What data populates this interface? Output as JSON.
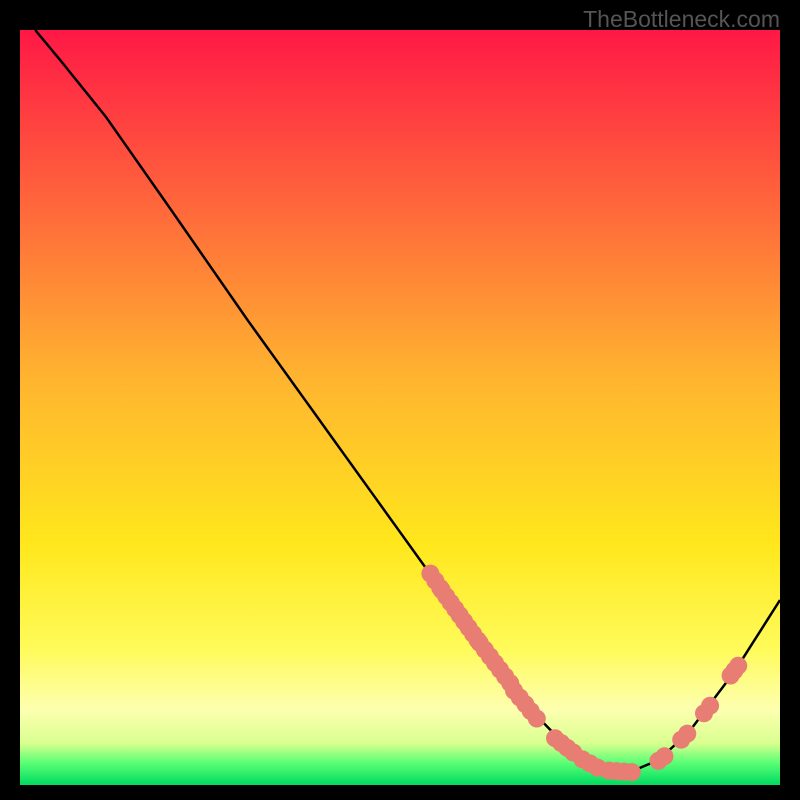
{
  "watermark": "TheBottleneck.com",
  "chart_data": {
    "type": "line",
    "title": "",
    "xlabel": "",
    "ylabel": "",
    "xlim": [
      0,
      100
    ],
    "ylim": [
      0,
      100
    ],
    "curve": [
      {
        "x": 2.0,
        "y": 100.0
      },
      {
        "x": 5.3,
        "y": 96.0
      },
      {
        "x": 11.3,
        "y": 88.5
      },
      {
        "x": 20.0,
        "y": 76.0
      },
      {
        "x": 30.0,
        "y": 61.5
      },
      {
        "x": 40.0,
        "y": 47.5
      },
      {
        "x": 50.0,
        "y": 33.5
      },
      {
        "x": 60.0,
        "y": 19.5
      },
      {
        "x": 66.7,
        "y": 10.5
      },
      {
        "x": 72.0,
        "y": 5.0
      },
      {
        "x": 76.0,
        "y": 2.3
      },
      {
        "x": 80.0,
        "y": 1.6
      },
      {
        "x": 84.0,
        "y": 3.3
      },
      {
        "x": 88.0,
        "y": 7.0
      },
      {
        "x": 94.0,
        "y": 15.0
      },
      {
        "x": 100.0,
        "y": 24.5
      }
    ],
    "dot_clusters": [
      {
        "x": 54.0,
        "x_end": 55.3,
        "y_start": 28.0,
        "y_end": 26.1
      },
      {
        "x": 55.5,
        "x_end": 60.2,
        "y_start": 25.8,
        "y_end": 19.2
      },
      {
        "x": 60.5,
        "x_end": 64.5,
        "y_start": 18.8,
        "y_end": 13.5
      },
      {
        "x": 65.0,
        "x_end": 66.5,
        "y_start": 12.5,
        "y_end": 10.7
      },
      {
        "x": 67.2,
        "x_end": 68.0,
        "y_start": 9.8,
        "y_end": 8.8
      },
      {
        "x": 70.4,
        "x_end": 72.8,
        "y_start": 6.2,
        "y_end": 4.3
      },
      {
        "x": 74.0,
        "x_end": 76.0,
        "y_start": 3.4,
        "y_end": 2.3
      },
      {
        "x": 77.5,
        "x_end": 80.5,
        "y_start": 1.9,
        "y_end": 1.7
      },
      {
        "x": 84.0,
        "x_end": 84.8,
        "y_start": 3.2,
        "y_end": 3.8
      },
      {
        "x": 87.0,
        "x_end": 87.8,
        "y_start": 6.0,
        "y_end": 6.8
      },
      {
        "x": 90.0,
        "x_end": 90.8,
        "y_start": 9.5,
        "y_end": 10.5
      },
      {
        "x": 93.5,
        "x_end": 94.5,
        "y_start": 14.5,
        "y_end": 15.8
      }
    ],
    "gradient_stops": [
      {
        "offset": 0.0,
        "color": "#ff1846"
      },
      {
        "offset": 0.46,
        "color": "#ffb430"
      },
      {
        "offset": 0.68,
        "color": "#ffe71c"
      },
      {
        "offset": 0.82,
        "color": "#fffb5a"
      },
      {
        "offset": 0.9,
        "color": "#fdffb0"
      },
      {
        "offset": 0.945,
        "color": "#d8ff8f"
      },
      {
        "offset": 0.97,
        "color": "#5cff75"
      },
      {
        "offset": 1.0,
        "color": "#00db60"
      }
    ]
  }
}
